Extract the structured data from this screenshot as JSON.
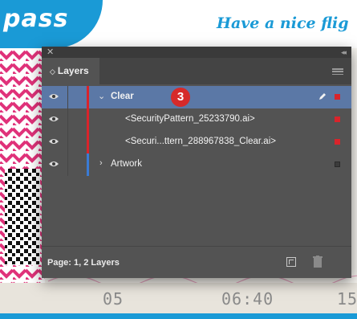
{
  "document": {
    "title_left": "pass",
    "title_right": "Have a nice flig",
    "bottom_numbers": [
      "05",
      "06:40",
      "15"
    ]
  },
  "panel": {
    "tab_label": "Layers",
    "layers": [
      {
        "label": "Clear",
        "expanded": true,
        "selected": true,
        "color": "#d9242b",
        "editable": true
      },
      {
        "label": "<SecurityPattern_25233790.ai>",
        "color": "#d9242b"
      },
      {
        "label": "<Securi...ttern_288967838_Clear.ai>",
        "color": "#d9242b"
      },
      {
        "label": "Artwork",
        "expanded": false,
        "color": "#3a7bd5"
      }
    ],
    "badge_number": "3",
    "status": "Page: 1, 2 Layers",
    "icons": [
      "close-icon",
      "collapse-icon",
      "panel-menu-icon",
      "eye-icon",
      "pencil-icon",
      "new-layer-icon",
      "trash-icon"
    ]
  },
  "colors": {
    "panel_bg": "#535353",
    "selection": "#5b78a6",
    "accent_blue": "#1a9ad6",
    "pattern_pink": "#e0327a"
  }
}
